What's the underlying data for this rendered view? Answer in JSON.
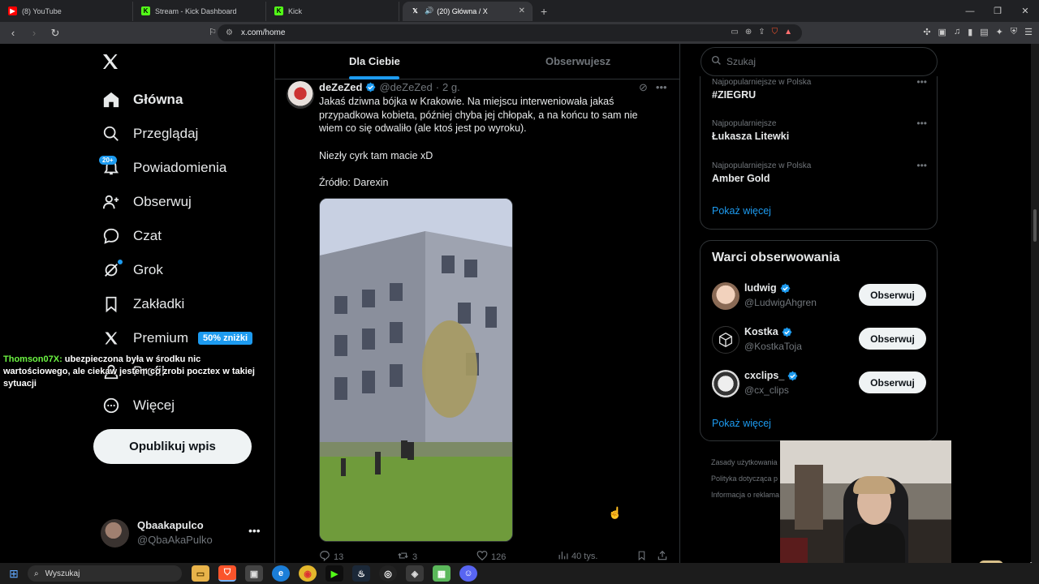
{
  "browser": {
    "tabs": [
      {
        "title": "(8) YouTube",
        "favicon": "youtube-icon",
        "color": "#ff0000"
      },
      {
        "title": "Stream - Kick Dashboard",
        "favicon": "kick-icon",
        "color": "#53fc18"
      },
      {
        "title": "Kick",
        "favicon": "kick-icon",
        "color": "#53fc18"
      },
      {
        "title": "(20) Główna / X",
        "favicon": "x-icon",
        "color": "#ffffff"
      }
    ],
    "url": "x.com/home"
  },
  "nav": {
    "items": [
      {
        "label": "Główna",
        "icon": "home-icon"
      },
      {
        "label": "Przeglądaj",
        "icon": "search-icon"
      },
      {
        "label": "Powiadomienia",
        "icon": "bell-icon"
      },
      {
        "label": "Obserwuj",
        "icon": "person-add-icon"
      },
      {
        "label": "Czat",
        "icon": "chat-icon"
      },
      {
        "label": "Grok",
        "icon": "grok-icon"
      },
      {
        "label": "Zakładki",
        "icon": "bookmark-icon"
      },
      {
        "label": "Premium",
        "icon": "x-icon"
      },
      {
        "label": "Profil",
        "icon": "person-icon"
      },
      {
        "label": "Więcej",
        "icon": "more-icon"
      }
    ],
    "notifications_badge": "20+",
    "premium_badge": "50% zniżki",
    "post_button": "Opublikuj wpis",
    "profile": {
      "name": "Qbaakapulco",
      "handle": "@QbaAkaPulko"
    }
  },
  "feed": {
    "tabs": [
      "Dla Ciebie",
      "Obserwujesz"
    ],
    "tweet": {
      "name": "deZeZed",
      "handle": "@deZeZed",
      "sep": "·",
      "time": "2 g.",
      "paragraphs": [
        "Jakaś dziwna bójka w Krakowie. Na miejscu interweniowała jakaś przypadkowa kobieta, później chyba jej chłopak, a na końcu to sam nie wiem co się odwaliło (ale ktoś jest po wyroku).",
        "Niezły cyrk tam macie xD",
        "Źródło: Darexin"
      ],
      "replies": "13",
      "reposts": "3",
      "likes": "126",
      "views": "40 tys."
    }
  },
  "sidebar": {
    "search_placeholder": "Szukaj",
    "trends": [
      {
        "category": "Najpopularniejsze w Polska",
        "title": "#ZIEGRU"
      },
      {
        "category": "Najpopularniejsze",
        "title": "Łukasza Litewki"
      },
      {
        "category": "Najpopularniejsze w Polska",
        "title": "Amber Gold"
      }
    ],
    "show_more": "Pokaż więcej",
    "who_to_follow": {
      "title": "Warci obserwowania",
      "accounts": [
        {
          "name": "ludwig",
          "handle": "@LudwigAhgren",
          "button": "Obserwuj"
        },
        {
          "name": "Kostka",
          "handle": "@KostkaToja",
          "button": "Obserwuj"
        },
        {
          "name": "cxclips_",
          "handle": "@cx_clips",
          "button": "Obserwuj"
        }
      ],
      "show_more": "Pokaż więcej"
    },
    "footer": [
      "Zasady użytkowania",
      "Polityka dotycząca p",
      "Informacja o reklama"
    ]
  },
  "chat": {
    "user": "Thomson07X:",
    "message": "ubezpieczona była w środku nic wartościowego, ale ciekaw jestem co zrobi pocztex w takiej sytuacji"
  },
  "taskbar": {
    "search_label": "Wyszukaj"
  },
  "colors": {
    "accent": "#1d9bf0",
    "background": "#000000",
    "border": "#2f3336",
    "muted": "#71767b"
  }
}
